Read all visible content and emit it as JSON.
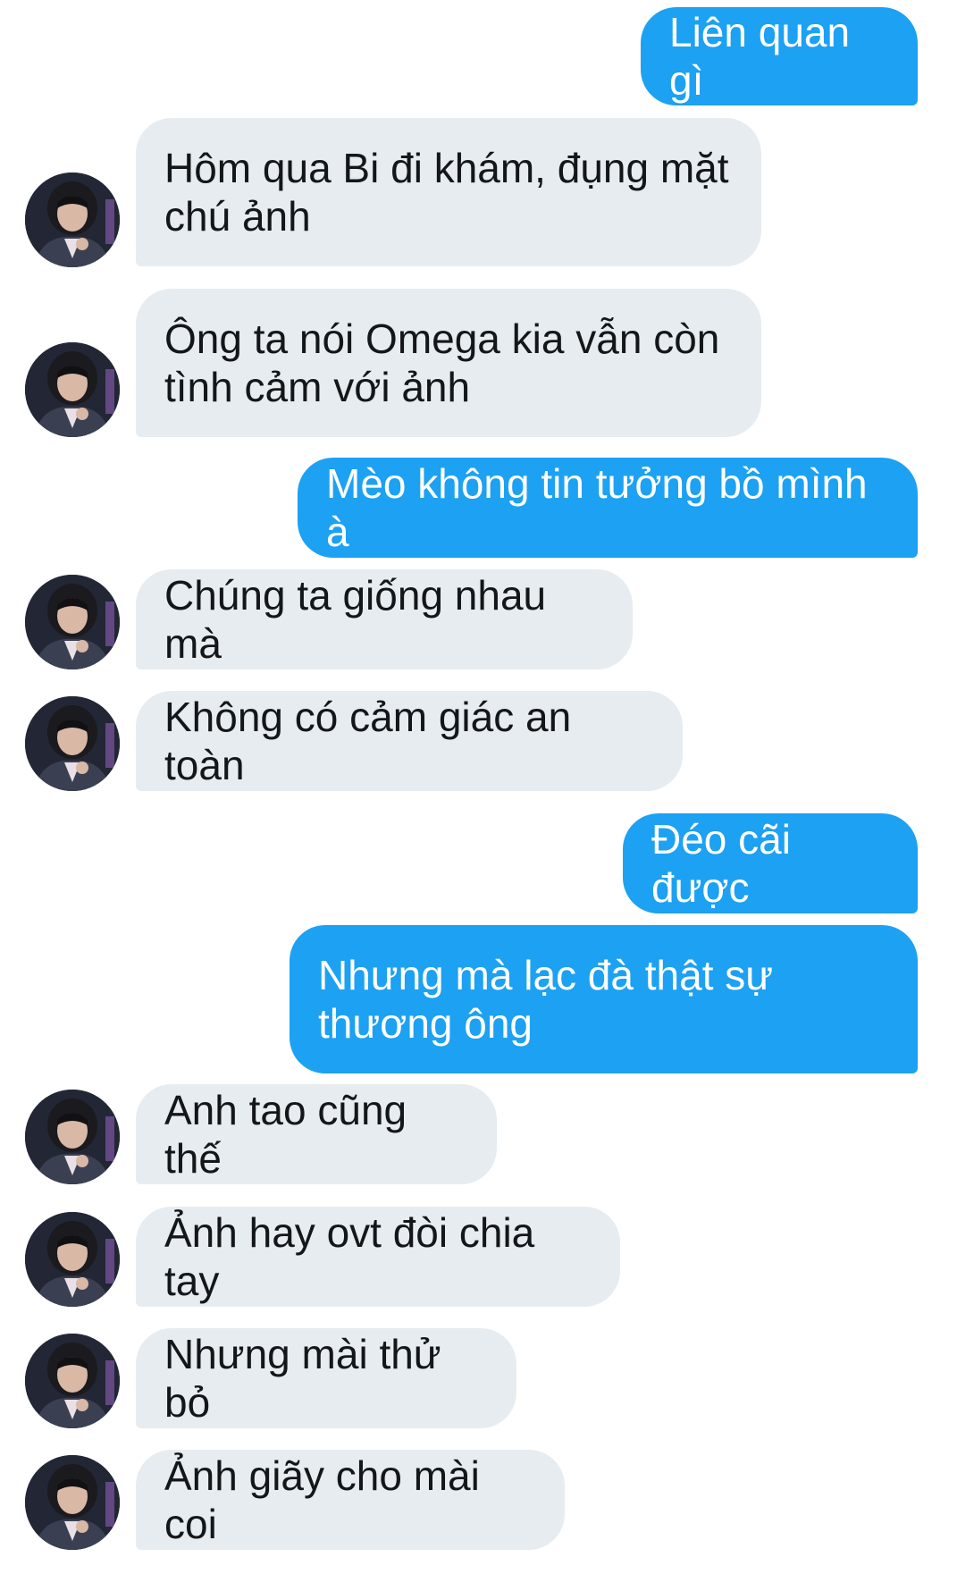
{
  "conversation": {
    "messages": [
      {
        "from": "me",
        "text": "Liên quan gì"
      },
      {
        "from": "them",
        "text": "Hôm qua Bi đi khám, đụng mặt chú ảnh"
      },
      {
        "from": "them",
        "text": "Ông ta nói Omega kia vẫn còn tình cảm với ảnh"
      },
      {
        "from": "me",
        "text": "Mèo không tin tưởng bồ mình à"
      },
      {
        "from": "them",
        "text": "Chúng ta giống nhau mà"
      },
      {
        "from": "them",
        "text": "Không có cảm giác an toàn"
      },
      {
        "from": "me",
        "text": "Đéo cãi được"
      },
      {
        "from": "me",
        "text": "Nhưng mà lạc đà thật sự thương ông"
      },
      {
        "from": "them",
        "text": "Anh tao cũng thế"
      },
      {
        "from": "them",
        "text": "Ảnh hay ovt đòi chia tay"
      },
      {
        "from": "them",
        "text": "Nhưng mài thử bỏ"
      },
      {
        "from": "them",
        "text": "Ảnh giãy cho mài coi"
      }
    ]
  },
  "colors": {
    "outgoing_bubble": "#1da1f2",
    "incoming_bubble": "#e7ecf0",
    "outgoing_text": "#ffffff",
    "incoming_text": "#14171a"
  },
  "icons": {
    "avatar": "contact-avatar-photo"
  }
}
